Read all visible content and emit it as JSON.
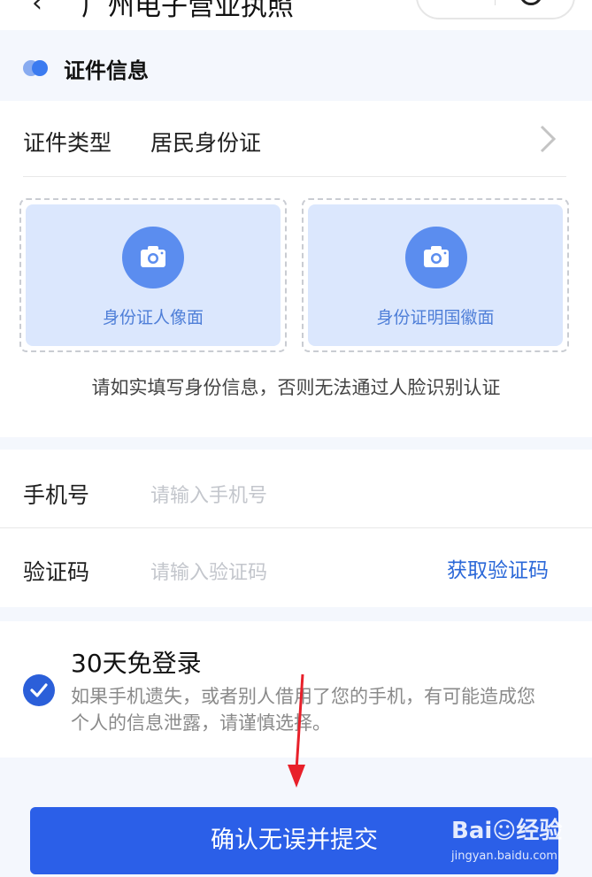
{
  "header": {
    "back_glyph": "‹",
    "title": "广州电子营业执照"
  },
  "section": {
    "title": "证件信息"
  },
  "id_type": {
    "label": "证件类型",
    "value": "居民身份证"
  },
  "uploads": [
    {
      "label": "身份证人像面",
      "icon": "camera-icon"
    },
    {
      "label": "身份证明国徽面",
      "icon": "camera-icon"
    }
  ],
  "notice": "请如实填写身份信息，否则无法通过人脸识别认证",
  "phone": {
    "label": "手机号",
    "placeholder": "请输入手机号"
  },
  "code": {
    "label": "验证码",
    "placeholder": "请输入验证码",
    "get_code": "获取验证码"
  },
  "remember": {
    "checked": true,
    "title": "30天免登录",
    "description": "如果手机遗失，或者别人借用了您的手机，有可能造成您个人的信息泄露，请谨慎选择。"
  },
  "confirm_label": "确认无误并提交",
  "watermark": {
    "logo": "Bai☺经验",
    "site": "jingyan.baidu.com"
  },
  "colors": {
    "accent": "#2b5fe8",
    "link": "#2b68d8",
    "upload_bg": "#dbe7fd",
    "annotation_arrow": "#e8202a"
  }
}
